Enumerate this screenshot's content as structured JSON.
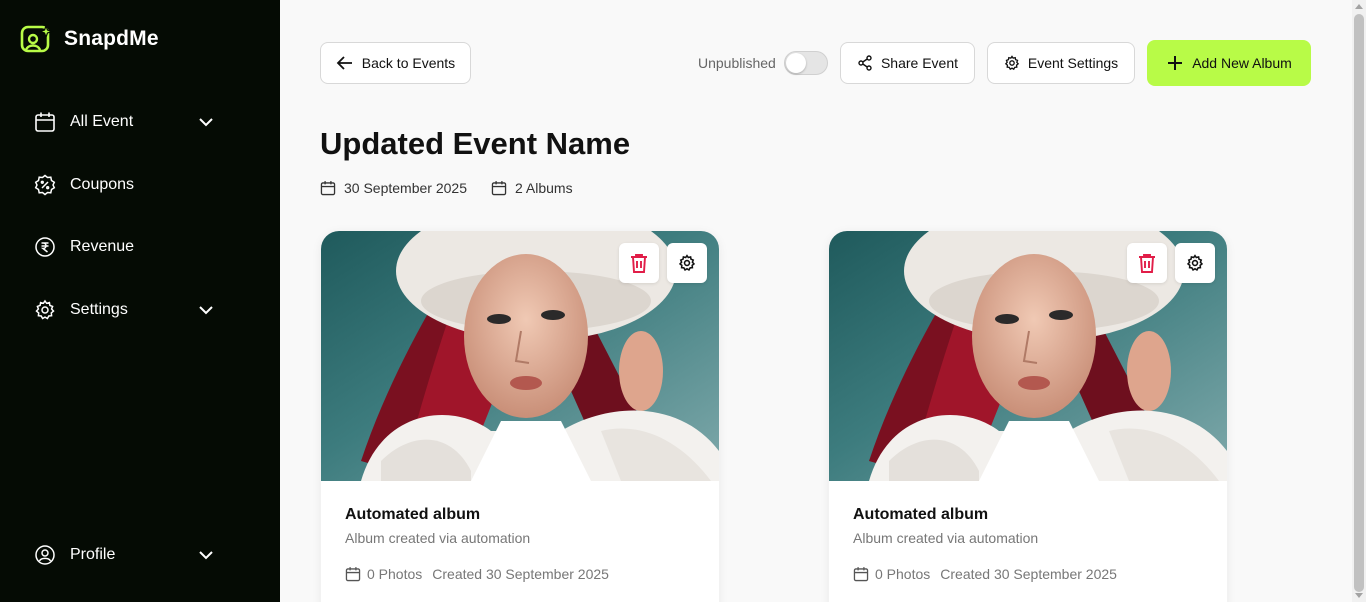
{
  "brand": {
    "name": "SnapdMe",
    "accent": "#b8fb47",
    "sidebar_bg": "#050b04"
  },
  "sidebar": {
    "items": [
      {
        "label": "All Event",
        "icon": "calendar-icon",
        "expandable": true
      },
      {
        "label": "Coupons",
        "icon": "coupon-icon",
        "expandable": false
      },
      {
        "label": "Revenue",
        "icon": "rupee-icon",
        "expandable": false
      },
      {
        "label": "Settings",
        "icon": "gear-icon",
        "expandable": true
      }
    ],
    "profile": {
      "label": "Profile",
      "icon": "user-circle-icon",
      "expandable": true
    }
  },
  "header": {
    "back_label": "Back to Events",
    "publish_label": "Unpublished",
    "published": false,
    "share_label": "Share Event",
    "settings_label": "Event Settings",
    "add_album_label": "Add New Album"
  },
  "event": {
    "title": "Updated Event Name",
    "date": "30 September 2025",
    "albums_count": "2 Albums"
  },
  "albums": [
    {
      "title": "Automated album",
      "subtitle": "Album created via automation",
      "photos": "0 Photos",
      "created": "Created 30 September 2025"
    },
    {
      "title": "Automated album",
      "subtitle": "Album created via automation",
      "photos": "0 Photos",
      "created": "Created 30 September 2025"
    }
  ]
}
